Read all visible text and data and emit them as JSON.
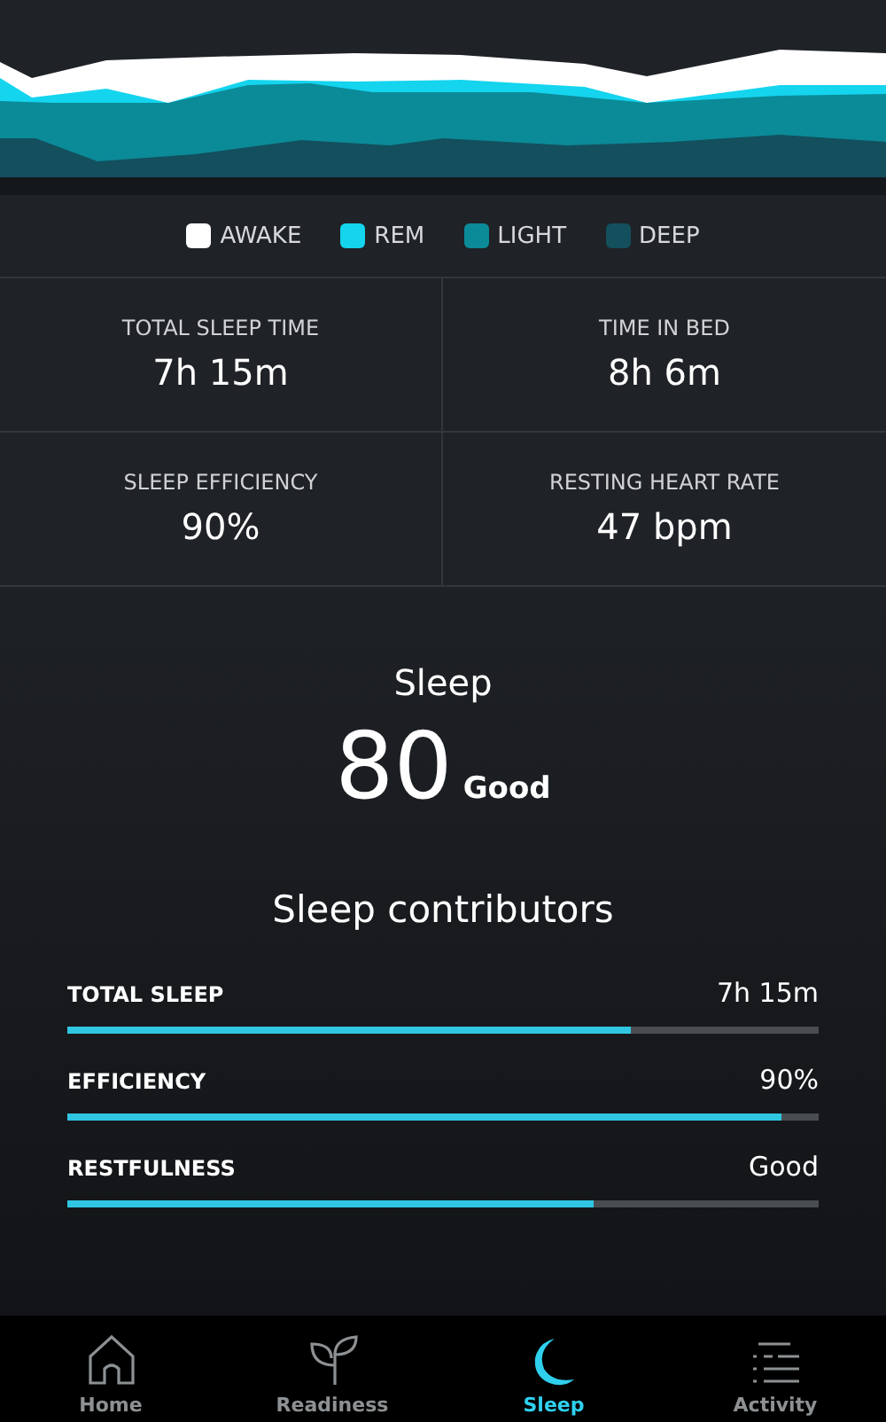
{
  "legend": [
    {
      "label": "AWAKE",
      "color": "#ffffff"
    },
    {
      "label": "REM",
      "color": "#14d4ee"
    },
    {
      "label": "LIGHT",
      "color": "#0b8a98"
    },
    {
      "label": "DEEP",
      "color": "#134f5c"
    }
  ],
  "stats": [
    {
      "label": "TOTAL SLEEP TIME",
      "value": "7h 15m"
    },
    {
      "label": "TIME IN BED",
      "value": "8h 6m"
    },
    {
      "label": "SLEEP EFFICIENCY",
      "value": "90%"
    },
    {
      "label": "RESTING HEART RATE",
      "value": "47 bpm"
    }
  ],
  "score": {
    "title": "Sleep",
    "value": "80",
    "rating": "Good"
  },
  "contributors_title": "Sleep contributors",
  "contributors": [
    {
      "label": "TOTAL SLEEP",
      "value": "7h 15m",
      "level": 0.75
    },
    {
      "label": "EFFICIENCY",
      "value": "90%",
      "level": 0.95
    },
    {
      "label": "RESTFULNESS",
      "value": "Good",
      "level": 0.7
    }
  ],
  "nav": [
    {
      "label": "Home",
      "selected": false
    },
    {
      "label": "Readiness",
      "selected": false
    },
    {
      "label": "Sleep",
      "selected": true
    },
    {
      "label": "Activity",
      "selected": false
    }
  ]
}
